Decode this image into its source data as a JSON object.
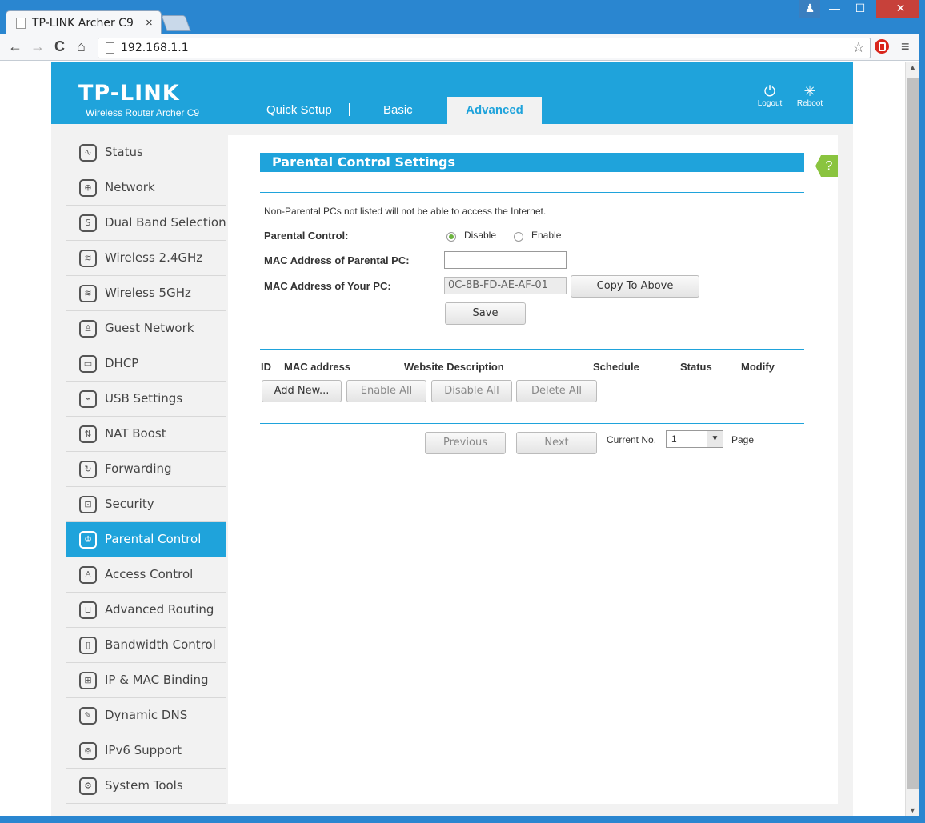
{
  "browser": {
    "tab_title": "TP-LINK Archer C9",
    "tab_close": "×",
    "url": "192.168.1.1",
    "back": "←",
    "forward": "→",
    "reload": "C",
    "home": "⌂",
    "star": "☆",
    "menu": "≡",
    "wc_min": "—",
    "wc_max": "☐",
    "wc_close": "✕",
    "user": "♟"
  },
  "header": {
    "logo": "TP-LINK",
    "model": "Wireless Router Archer C9",
    "nav": [
      "Quick Setup",
      "Basic",
      "Advanced"
    ],
    "active_nav": "Advanced",
    "logout_label": "Logout",
    "reboot_label": "Reboot",
    "logout_glyph": "⏻",
    "reboot_glyph": "✳"
  },
  "sidebar": {
    "items": [
      {
        "label": "Status",
        "icon": "status-icon",
        "glyph": "∿"
      },
      {
        "label": "Network",
        "icon": "globe-icon",
        "glyph": "⊕"
      },
      {
        "label": "Dual Band Selection",
        "icon": "dual-band-icon",
        "glyph": "S"
      },
      {
        "label": "Wireless 2.4GHz",
        "icon": "wifi-icon",
        "glyph": "≋"
      },
      {
        "label": "Wireless 5GHz",
        "icon": "wifi-icon",
        "glyph": "≋"
      },
      {
        "label": "Guest Network",
        "icon": "guests-icon",
        "glyph": "♙"
      },
      {
        "label": "DHCP",
        "icon": "monitor-icon",
        "glyph": "▭"
      },
      {
        "label": "USB Settings",
        "icon": "usb-icon",
        "glyph": "⌁"
      },
      {
        "label": "NAT Boost",
        "icon": "nat-boost-icon",
        "glyph": "⇅"
      },
      {
        "label": "Forwarding",
        "icon": "forwarding-icon",
        "glyph": "↻"
      },
      {
        "label": "Security",
        "icon": "lock-icon",
        "glyph": "⊡"
      },
      {
        "label": "Parental Control",
        "icon": "family-icon",
        "glyph": "♔"
      },
      {
        "label": "Access Control",
        "icon": "user-lock-icon",
        "glyph": "♙"
      },
      {
        "label": "Advanced Routing",
        "icon": "routing-icon",
        "glyph": "⊔"
      },
      {
        "label": "Bandwidth Control",
        "icon": "bandwidth-icon",
        "glyph": "▯"
      },
      {
        "label": "IP & MAC Binding",
        "icon": "binding-icon",
        "glyph": "⊞"
      },
      {
        "label": "Dynamic DNS",
        "icon": "ddns-icon",
        "glyph": "✎"
      },
      {
        "label": "IPv6 Support",
        "icon": "ipv6-icon",
        "glyph": "⊚"
      },
      {
        "label": "System Tools",
        "icon": "gear-icon",
        "glyph": "⚙"
      }
    ],
    "active_index": 11
  },
  "content": {
    "title": "Parental Control Settings",
    "help": "?",
    "note": "Non-Parental PCs not listed will not be able to access the Internet.",
    "parental_control_label": "Parental Control:",
    "radio_disable": "Disable",
    "radio_enable": "Enable",
    "radio_selected": "Disable",
    "mac_parental_label": "MAC Address of Parental PC:",
    "mac_parental_value": "",
    "mac_your_label": "MAC Address of Your PC:",
    "mac_your_value": "0C-8B-FD-AE-AF-01",
    "copy_button": "Copy To Above",
    "save_button": "Save",
    "table_headers": [
      "ID",
      "MAC address",
      "Website Description",
      "Schedule",
      "Status",
      "Modify"
    ],
    "add_new": "Add New...",
    "enable_all": "Enable All",
    "disable_all": "Disable All",
    "delete_all": "Delete All",
    "previous": "Previous",
    "next": "Next",
    "current_no_label": "Current No.",
    "current_no_value": "1",
    "page_label": "Page",
    "select_arrow": "▼"
  },
  "colors": {
    "brand": "#1fa3db",
    "help": "#8ac43f",
    "radio_on": "#6cb33f"
  }
}
